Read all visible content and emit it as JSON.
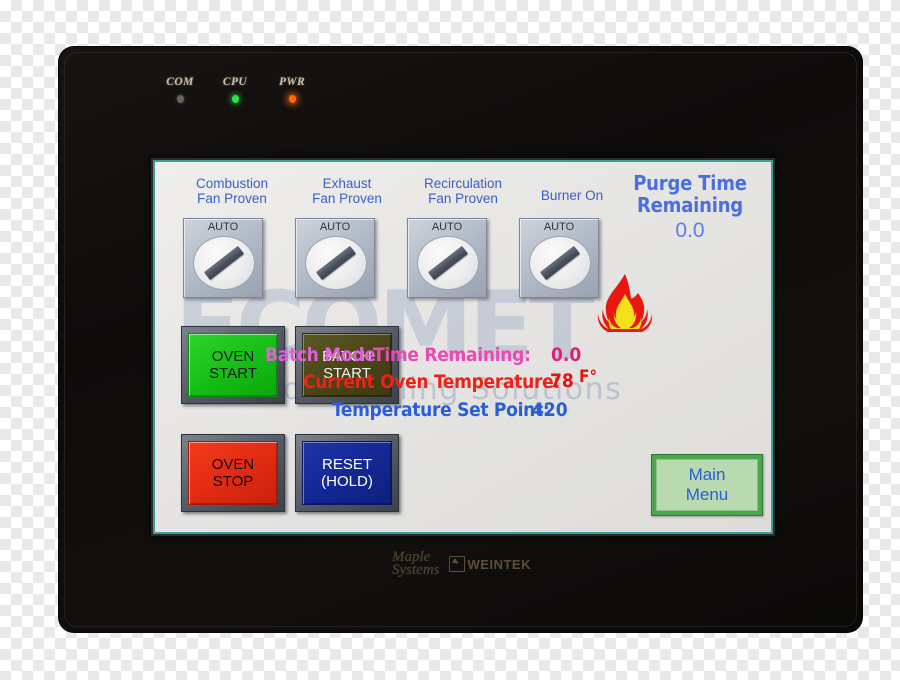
{
  "device": {
    "leds": [
      {
        "name": "COM",
        "color": "#6d6257",
        "state": "off"
      },
      {
        "name": "CPU",
        "color": "#2ee14a",
        "state": "on"
      },
      {
        "name": "PWR",
        "color": "#ff6a12",
        "state": "on"
      }
    ],
    "brand": {
      "maple_line1": "Maple",
      "maple_line2": "Systems",
      "weintek": "WEINTEK"
    }
  },
  "screen": {
    "watermark": {
      "logo": "ECOMET",
      "tagline": "ed Finishing Solutions"
    },
    "status_headers": [
      {
        "label": "Combustion\nFan Proven",
        "switch_label": "AUTO",
        "switch_position": "auto"
      },
      {
        "label": "Exhaust\nFan Proven",
        "switch_label": "AUTO",
        "switch_position": "auto"
      },
      {
        "label": "Recirculation\nFan Proven",
        "switch_label": "AUTO",
        "switch_position": "auto"
      },
      {
        "label": "Burner On",
        "switch_label": "AUTO",
        "switch_position": "auto"
      }
    ],
    "purge": {
      "title": "Purge Time\nRemaining",
      "value": "0.0"
    },
    "buttons": [
      {
        "label": "OVEN\nSTART",
        "style": "green"
      },
      {
        "label": "BATCH\nSTART",
        "style": "olive"
      },
      {
        "label": "OVEN\nSTOP",
        "style": "red"
      },
      {
        "label": "RESET\n(HOLD)",
        "style": "blue"
      }
    ],
    "readouts": {
      "batch_mode": "Batch Mode",
      "time_remaining_label": "Time Remaining:",
      "time_remaining_value": "0.0",
      "current_temp_label": "Current Oven Temperature:",
      "current_temp_value": "78",
      "current_temp_unit": "F°",
      "setpoint_label": "Temperature Set Point:",
      "setpoint_value": "420"
    },
    "main_menu": "Main\nMenu",
    "flame_indicator": "burner-flame-active",
    "colors": {
      "header_blue": "#3a5fc8",
      "purge_blue": "#4a6fe0",
      "magenta": "#e84bb4",
      "red": "#ef2116",
      "setpoint_blue": "#2b5ed6",
      "screen_border": "#3e9f9a"
    }
  }
}
